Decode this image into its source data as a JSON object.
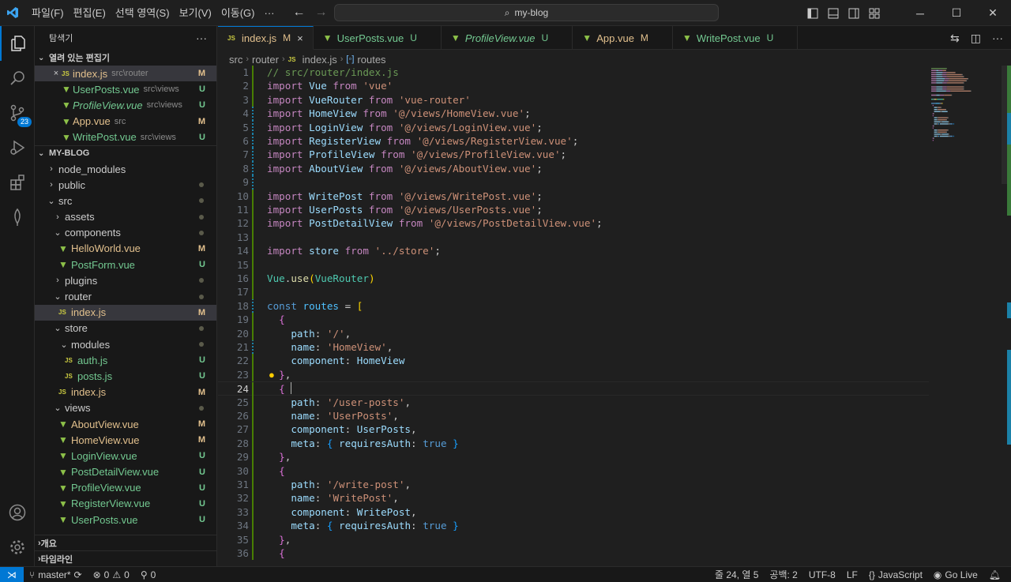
{
  "titlebar": {
    "menu": [
      "파일(F)",
      "편집(E)",
      "선택 영역(S)",
      "보기(V)",
      "이동(G)",
      "···"
    ],
    "search_text": "my-blog"
  },
  "activity": {
    "source_control_badge": "23"
  },
  "sidebar": {
    "title": "탐색기",
    "open_editors_title": "열려 있는 편집기",
    "open_editors": [
      {
        "name": "index.js",
        "path": "src\\router",
        "status": "M",
        "type": "js",
        "close": "×"
      },
      {
        "name": "UserPosts.vue",
        "path": "src\\views",
        "status": "U",
        "type": "vue"
      },
      {
        "name": "ProfileView.vue",
        "path": "src\\views",
        "status": "U",
        "type": "vue",
        "italic": true
      },
      {
        "name": "App.vue",
        "path": "src",
        "status": "M",
        "type": "vue"
      },
      {
        "name": "WritePost.vue",
        "path": "src\\views",
        "status": "U",
        "type": "vue"
      }
    ],
    "project_title": "MY-BLOG",
    "tree": [
      {
        "name": "node_modules",
        "depth": 0,
        "kind": "folder",
        "open": false
      },
      {
        "name": "public",
        "depth": 0,
        "kind": "folder",
        "open": false,
        "dot": true
      },
      {
        "name": "src",
        "depth": 0,
        "kind": "folder",
        "open": true,
        "dot": true
      },
      {
        "name": "assets",
        "depth": 1,
        "kind": "folder",
        "open": false,
        "dot": true
      },
      {
        "name": "components",
        "depth": 1,
        "kind": "folder",
        "open": true,
        "dot": true
      },
      {
        "name": "HelloWorld.vue",
        "depth": 2,
        "kind": "vue",
        "status": "M"
      },
      {
        "name": "PostForm.vue",
        "depth": 2,
        "kind": "vue",
        "status": "U"
      },
      {
        "name": "plugins",
        "depth": 1,
        "kind": "folder",
        "open": false,
        "dot": true
      },
      {
        "name": "router",
        "depth": 1,
        "kind": "folder",
        "open": true,
        "dot": true
      },
      {
        "name": "index.js",
        "depth": 2,
        "kind": "js",
        "status": "M",
        "selected": true
      },
      {
        "name": "store",
        "depth": 1,
        "kind": "folder",
        "open": true,
        "dot": true
      },
      {
        "name": "modules",
        "depth": 2,
        "kind": "folder",
        "open": true,
        "dot": true
      },
      {
        "name": "auth.js",
        "depth": 3,
        "kind": "js",
        "status": "U"
      },
      {
        "name": "posts.js",
        "depth": 3,
        "kind": "js",
        "status": "U"
      },
      {
        "name": "index.js",
        "depth": 2,
        "kind": "js",
        "status": "M"
      },
      {
        "name": "views",
        "depth": 1,
        "kind": "folder",
        "open": true,
        "dot": true
      },
      {
        "name": "AboutView.vue",
        "depth": 2,
        "kind": "vue",
        "status": "M"
      },
      {
        "name": "HomeView.vue",
        "depth": 2,
        "kind": "vue",
        "status": "M"
      },
      {
        "name": "LoginView.vue",
        "depth": 2,
        "kind": "vue",
        "status": "U"
      },
      {
        "name": "PostDetailView.vue",
        "depth": 2,
        "kind": "vue",
        "status": "U"
      },
      {
        "name": "ProfileView.vue",
        "depth": 2,
        "kind": "vue",
        "status": "U"
      },
      {
        "name": "RegisterView.vue",
        "depth": 2,
        "kind": "vue",
        "status": "U"
      },
      {
        "name": "UserPosts.vue",
        "depth": 2,
        "kind": "vue",
        "status": "U"
      }
    ],
    "outline_title": "개요",
    "timeline_title": "타임라인"
  },
  "tabs": [
    {
      "name": "index.js",
      "status": "M",
      "type": "js",
      "active": true,
      "close": "×"
    },
    {
      "name": "UserPosts.vue",
      "status": "U",
      "type": "vue"
    },
    {
      "name": "ProfileView.vue",
      "status": "U",
      "type": "vue",
      "italic": true
    },
    {
      "name": "App.vue",
      "status": "M",
      "type": "vue"
    },
    {
      "name": "WritePost.vue",
      "status": "U",
      "type": "vue"
    }
  ],
  "breadcrumb": [
    "src",
    "router",
    "index.js",
    "routes"
  ],
  "editor": {
    "current_line": 24,
    "lines": [
      [
        [
          "c-com",
          "// src/router/index.js"
        ]
      ],
      [
        [
          "c-imp",
          "import "
        ],
        [
          "c-id",
          "Vue"
        ],
        [
          "c-imp",
          " from "
        ],
        [
          "c-str",
          "'vue'"
        ]
      ],
      [
        [
          "c-imp",
          "import "
        ],
        [
          "c-id",
          "VueRouter"
        ],
        [
          "c-imp",
          " from "
        ],
        [
          "c-str",
          "'vue-router'"
        ]
      ],
      [
        [
          "c-imp",
          "import "
        ],
        [
          "c-id",
          "HomeView"
        ],
        [
          "c-imp",
          " from "
        ],
        [
          "c-str",
          "'@/views/HomeView.vue'"
        ],
        [
          "c-pl",
          ";"
        ]
      ],
      [
        [
          "c-imp",
          "import "
        ],
        [
          "c-id",
          "LoginView"
        ],
        [
          "c-imp",
          " from "
        ],
        [
          "c-str",
          "'@/views/LoginView.vue'"
        ],
        [
          "c-pl",
          ";"
        ]
      ],
      [
        [
          "c-imp",
          "import "
        ],
        [
          "c-id",
          "RegisterView"
        ],
        [
          "c-imp",
          " from "
        ],
        [
          "c-str",
          "'@/views/RegisterView.vue'"
        ],
        [
          "c-pl",
          ";"
        ]
      ],
      [
        [
          "c-imp",
          "import "
        ],
        [
          "c-id",
          "ProfileView"
        ],
        [
          "c-imp",
          " from "
        ],
        [
          "c-str",
          "'@/views/ProfileView.vue'"
        ],
        [
          "c-pl",
          ";"
        ]
      ],
      [
        [
          "c-imp",
          "import "
        ],
        [
          "c-id",
          "AboutView"
        ],
        [
          "c-imp",
          " from "
        ],
        [
          "c-str",
          "'@/views/AboutView.vue'"
        ],
        [
          "c-pl",
          ";"
        ]
      ],
      [],
      [
        [
          "c-imp",
          "import "
        ],
        [
          "c-id",
          "WritePost"
        ],
        [
          "c-imp",
          " from "
        ],
        [
          "c-str",
          "'@/views/WritePost.vue'"
        ],
        [
          "c-pl",
          ";"
        ]
      ],
      [
        [
          "c-imp",
          "import "
        ],
        [
          "c-id",
          "UserPosts"
        ],
        [
          "c-imp",
          " from "
        ],
        [
          "c-str",
          "'@/views/UserPosts.vue'"
        ],
        [
          "c-pl",
          ";"
        ]
      ],
      [
        [
          "c-imp",
          "import "
        ],
        [
          "c-id",
          "PostDetailView"
        ],
        [
          "c-imp",
          " from "
        ],
        [
          "c-str",
          "'@/views/PostDetailView.vue'"
        ],
        [
          "c-pl",
          ";"
        ]
      ],
      [],
      [
        [
          "c-imp",
          "import "
        ],
        [
          "c-id",
          "store"
        ],
        [
          "c-imp",
          " from "
        ],
        [
          "c-str",
          "'../store'"
        ],
        [
          "c-pl",
          ";"
        ]
      ],
      [],
      [
        [
          "c-cls",
          "Vue"
        ],
        [
          "c-pl",
          "."
        ],
        [
          "c-fn",
          "use"
        ],
        [
          "c-br1",
          "("
        ],
        [
          "c-cls",
          "VueRouter"
        ],
        [
          "c-br1",
          ")"
        ]
      ],
      [],
      [
        [
          "c-kw",
          "const "
        ],
        [
          "c-con",
          "routes"
        ],
        [
          "c-pl",
          " = "
        ],
        [
          "c-br1",
          "["
        ]
      ],
      [
        [
          "c-pl",
          "  "
        ],
        [
          "c-br2",
          "{"
        ]
      ],
      [
        [
          "c-pl",
          "    "
        ],
        [
          "c-id",
          "path"
        ],
        [
          "c-pl",
          ": "
        ],
        [
          "c-str",
          "'/'"
        ],
        [
          "c-pl",
          ","
        ]
      ],
      [
        [
          "c-pl",
          "    "
        ],
        [
          "c-id",
          "name"
        ],
        [
          "c-pl",
          ": "
        ],
        [
          "c-str",
          "'HomeView'"
        ],
        [
          "c-pl",
          ","
        ]
      ],
      [
        [
          "c-pl",
          "    "
        ],
        [
          "c-id",
          "component"
        ],
        [
          "c-pl",
          ": "
        ],
        [
          "c-id",
          "HomeView"
        ]
      ],
      [
        [
          "c-pl",
          "  "
        ],
        [
          "c-br2",
          "}"
        ],
        [
          "c-pl",
          ","
        ]
      ],
      [
        [
          "c-pl",
          "  "
        ],
        [
          "c-br2",
          "{"
        ]
      ],
      [
        [
          "c-pl",
          "    "
        ],
        [
          "c-id",
          "path"
        ],
        [
          "c-pl",
          ": "
        ],
        [
          "c-str",
          "'/user-posts'"
        ],
        [
          "c-pl",
          ","
        ]
      ],
      [
        [
          "c-pl",
          "    "
        ],
        [
          "c-id",
          "name"
        ],
        [
          "c-pl",
          ": "
        ],
        [
          "c-str",
          "'UserPosts'"
        ],
        [
          "c-pl",
          ","
        ]
      ],
      [
        [
          "c-pl",
          "    "
        ],
        [
          "c-id",
          "component"
        ],
        [
          "c-pl",
          ": "
        ],
        [
          "c-id",
          "UserPosts"
        ],
        [
          "c-pl",
          ","
        ]
      ],
      [
        [
          "c-pl",
          "    "
        ],
        [
          "c-id",
          "meta"
        ],
        [
          "c-pl",
          ": "
        ],
        [
          "c-br3",
          "{"
        ],
        [
          "c-pl",
          " "
        ],
        [
          "c-id",
          "requiresAuth"
        ],
        [
          "c-pl",
          ": "
        ],
        [
          "c-kw",
          "true"
        ],
        [
          "c-pl",
          " "
        ],
        [
          "c-br3",
          "}"
        ]
      ],
      [
        [
          "c-pl",
          "  "
        ],
        [
          "c-br2",
          "}"
        ],
        [
          "c-pl",
          ","
        ]
      ],
      [
        [
          "c-pl",
          "  "
        ],
        [
          "c-br2",
          "{"
        ]
      ],
      [
        [
          "c-pl",
          "    "
        ],
        [
          "c-id",
          "path"
        ],
        [
          "c-pl",
          ": "
        ],
        [
          "c-str",
          "'/write-post'"
        ],
        [
          "c-pl",
          ","
        ]
      ],
      [
        [
          "c-pl",
          "    "
        ],
        [
          "c-id",
          "name"
        ],
        [
          "c-pl",
          ": "
        ],
        [
          "c-str",
          "'WritePost'"
        ],
        [
          "c-pl",
          ","
        ]
      ],
      [
        [
          "c-pl",
          "    "
        ],
        [
          "c-id",
          "component"
        ],
        [
          "c-pl",
          ": "
        ],
        [
          "c-id",
          "WritePost"
        ],
        [
          "c-pl",
          ","
        ]
      ],
      [
        [
          "c-pl",
          "    "
        ],
        [
          "c-id",
          "meta"
        ],
        [
          "c-pl",
          ": "
        ],
        [
          "c-br3",
          "{"
        ],
        [
          "c-pl",
          " "
        ],
        [
          "c-id",
          "requiresAuth"
        ],
        [
          "c-pl",
          ": "
        ],
        [
          "c-kw",
          "true"
        ],
        [
          "c-pl",
          " "
        ],
        [
          "c-br3",
          "}"
        ]
      ],
      [
        [
          "c-pl",
          "  "
        ],
        [
          "c-br2",
          "}"
        ],
        [
          "c-pl",
          ","
        ]
      ],
      [
        [
          "c-pl",
          "  "
        ],
        [
          "c-br2",
          "{"
        ]
      ]
    ],
    "gutter": {
      "modified": [
        4,
        5,
        6,
        7,
        8,
        9,
        18,
        21
      ],
      "added": [
        1,
        2,
        3,
        10,
        11,
        12,
        13,
        14,
        15,
        16,
        17,
        19,
        20,
        22,
        23,
        24,
        25,
        26,
        27,
        28,
        29,
        30,
        31,
        32,
        33,
        34,
        35,
        36
      ]
    }
  },
  "status": {
    "branch": "master*",
    "errors": "0",
    "warnings": "0",
    "ports": "0",
    "position": "줄 24, 열 5",
    "indent": "공백: 2",
    "encoding": "UTF-8",
    "eol": "LF",
    "language": "JavaScript",
    "golive": "Go Live"
  }
}
